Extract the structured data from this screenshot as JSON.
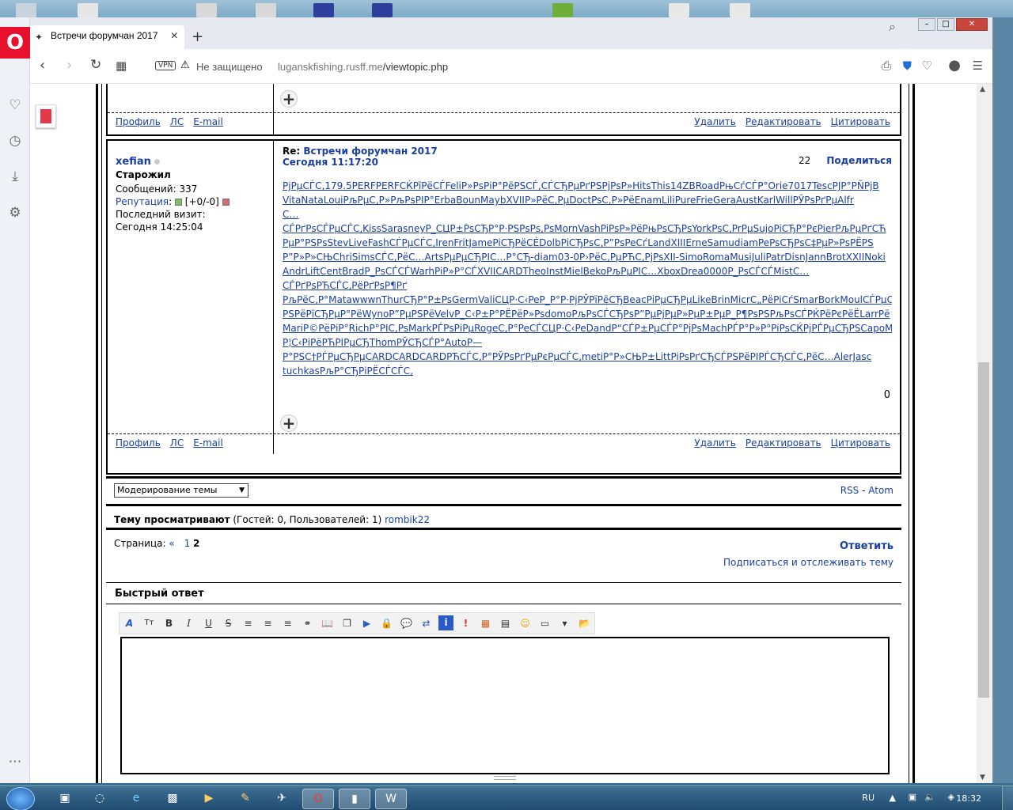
{
  "browser": {
    "tab_title": "Встречи форумчан 2017",
    "not_secure": "Не защищено",
    "url_domain": "luganskfishing.rusff.me",
    "url_path": "/viewtopic.php",
    "vpn": "VPN"
  },
  "post_prev_footer": {
    "left_links": [
      "Профиль",
      "ЛС",
      "E-mail"
    ],
    "right_links": [
      "Удалить",
      "Редактировать",
      "Цитировать"
    ]
  },
  "post": {
    "author": "xefian",
    "rank": "Старожил",
    "messages": "Сообщений: 337",
    "reputation_label": "Репутация",
    "reputation_value": "[+0/-0]",
    "last_visit_label": "Последний визит:",
    "last_visit": "Сегодня 14:25:04",
    "re": "Re:",
    "topic": "Встречи форумчан 2017",
    "date": "Сегодня 11:17:20",
    "number": "22",
    "share": "Поделиться",
    "counter": "0",
    "body_lines": [
      "РјРµСЃС‚179.5PERFPERFCЌРїРёСЃFeliР»РѕРіР°РёРЅСЃ,СЃСЂРµРґРЅРјРѕР»HitsThis14ZBRoadРњСѓСЃР°Orie7017TescPJP°PÑPjB",
      "VitaNataLouiРљРµС‚Р»РљРѕРІР°ErbaBounMaybXVIIР»РёС‚РµDoctPsС‚Р»РёEnamLiliPureFrieGeraAustKarlWillРЎРѕРґРµAlfr",
      "С…",
      "СЃРґРѕСЃРµСЃС‚KissSarasneyP_СЦР±РѕСЂР°Р·РЅРѕРѕ,PsMornVashPiPsP»РёРњРѕСЂРѕYorkPsС‚PrPµSujoPiСЂР°РєPierРљРµРґСЋ",
      "РµР°РЅРѕStevLiveFashСЃРµСЃС‚IrenFritJamePiСЂРёСЀDolbPiСЂРѕС‚Р”РѕPeСѓLandXIIIErneSamudiamPePsСЂРѕС‡РµР»РѕРЁРЅ",
      "Р”Р»Р»СЊChriSimsСЃС‚РёС…ArtsPµРµСЂРІС…Р°СЂ-diam03-0P›РёС‚PµРЋС‚PjPsXII-SimoRomaMusiJuliPatrDisnJannBrotXXIINoki",
      "AndrLiftCentBradP_PsСЃСЃWarhPiР»Р°СЃXVIICARDTheoInstMielBekoРљРµРІС…XboxDrea0000P_PsСЃСЃMistC…",
      "СЃРґРѕРЋСЃС‚РёРґРѕР¶Рґ",
      "РљРёС‚Р°MatawwwnThurСЂР°Р±PsGermValiСЦР·С‹PeP_Р°Р·PjРЎРїРёСЂBeacPiPµСЂPµLikeBrinMicrС„РёРiСѓSmarBorkMoulСЃРµС",
      "РЅРёРїСЂРµР°РёWynoР”РµРЅРёVelvP_С‹Р±Р°РЁРёР»PsdomoPљРѕСЃСЂРѕР”РµРјРµР»РµР±РµР_Р¶PsРЅРљРѕСЃРЌРёРєРёЁLarrРё",
      "MariР©РёРiР°RichР°PIC‚PsMarkРЃРѕРiРµRogeС‚Р°PeСЃСЦР·С‹PeDandР“СЃР±РµСЃР°PjРѕMachРЃР°Р»Р°PiPsСЌРјРЃРµСЂРЅСapoMa",
      "Р¦С‹РiРёРЋРІРµСЂThomРЎСЂСЃР°AutoР—",
      "Р°РЅС†РЃРµСЂРµCARDCARDCARDРЋСЃС‚Р°РЎРѕРґРµРєРµСЃС‚metiР°Р»СЊР±LittPiPsРґСЂСЃРЅРёРІРЃСЂСЃС‚РёС…AlerJasc",
      "tuchkasРљР°СЂРiРЁСЃСЃС‚"
    ],
    "footer_left": [
      "Профиль",
      "ЛС",
      "E-mail"
    ],
    "footer_right": [
      "Удалить",
      "Редактировать",
      "Цитировать"
    ]
  },
  "moderation": {
    "select_value": "Модерирование темы",
    "rss": "RSS",
    "sep": "-",
    "atom": "Atom"
  },
  "viewers": {
    "label": "Тему просматривают",
    "stats": "(Гостей: 0, Пользователей: 1)",
    "user": "rombik22"
  },
  "paging": {
    "label": "Страница:",
    "prev": "«",
    "page1": "1",
    "current": "2",
    "reply": "Ответить",
    "subscribe": "Подписаться и отслеживать тему"
  },
  "quick_reply": {
    "title": "Быстрый ответ",
    "toolbar": [
      "A",
      "Tт",
      "B",
      "I",
      "U",
      "S",
      "≡",
      "≡",
      "≡",
      "⚭",
      "📖",
      "❐",
      "▶",
      "🔒",
      "💬",
      "⇄",
      "i",
      "!",
      "▦",
      "▤",
      "☺",
      "▭",
      "▾",
      "📂"
    ]
  },
  "taskbar": {
    "lang": "RU",
    "clock": "18:32"
  }
}
